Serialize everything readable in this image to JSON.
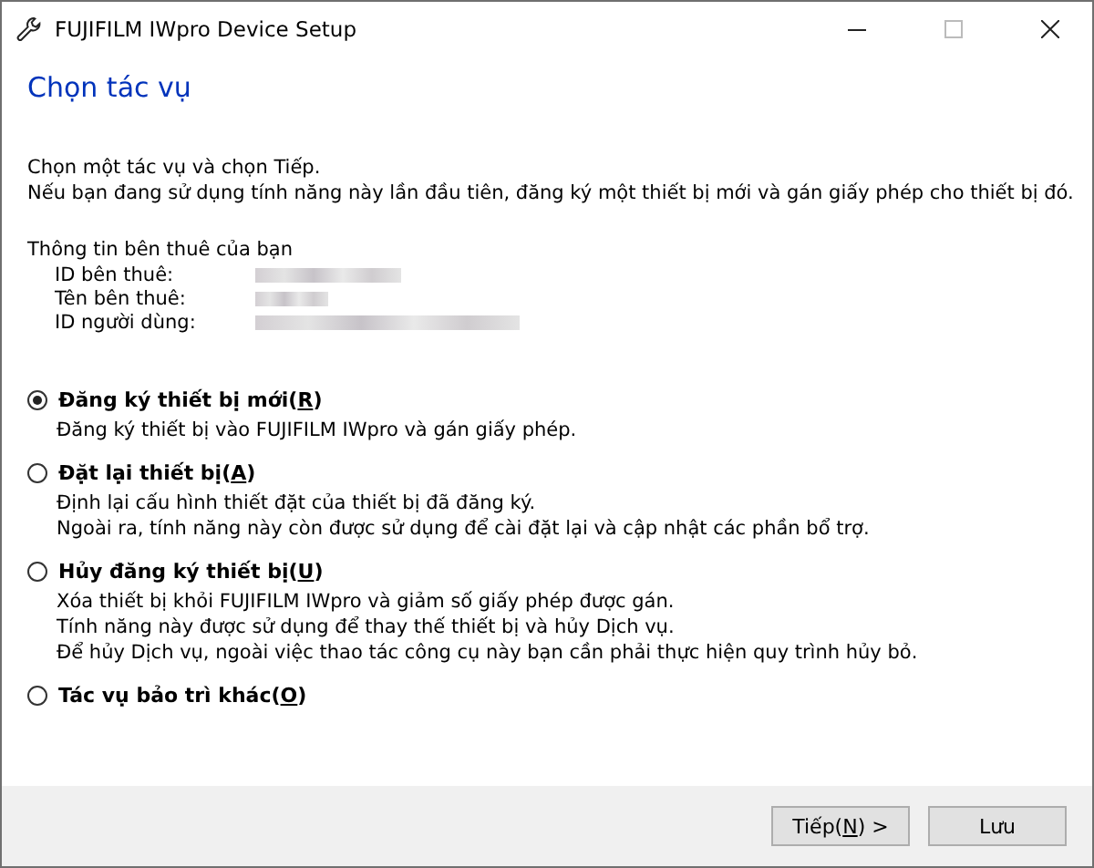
{
  "window": {
    "title": "FUJIFILM IWpro Device Setup"
  },
  "heading": "Chọn tác vụ",
  "intro": [
    "Chọn một tác vụ và chọn Tiếp.",
    "Nếu bạn đang sử dụng tính năng này lần đầu tiên, đăng ký một thiết bị mới và gán giấy phép cho thiết bị đó."
  ],
  "tenant": {
    "title": "Thông tin bên thuê của bạn",
    "rows": [
      {
        "label": "ID bên thuê:",
        "blurred": true
      },
      {
        "label": "Tên bên thuê:",
        "blurred": true
      },
      {
        "label": "ID người dùng:",
        "blurred": true
      }
    ]
  },
  "options": [
    {
      "label": "Đăng ký thiết bị mới(",
      "key": "R",
      "suffix": ")",
      "selected": true,
      "description": [
        "Đăng ký thiết bị vào FUJIFILM IWpro và gán giấy phép."
      ]
    },
    {
      "label": "Đặt lại thiết bị(",
      "key": "A",
      "suffix": ")",
      "selected": false,
      "description": [
        "Định lại cấu hình thiết đặt của thiết bị đã đăng ký.",
        "Ngoài ra, tính năng này còn được sử dụng để cài đặt lại và cập nhật các phần bổ trợ."
      ]
    },
    {
      "label": "Hủy đăng ký thiết bị(",
      "key": "U",
      "suffix": ")",
      "selected": false,
      "description": [
        "Xóa thiết bị khỏi FUJIFILM IWpro và giảm số giấy phép được gán.",
        "Tính năng này được sử dụng để thay thế thiết bị và hủy Dịch vụ.",
        "Để hủy Dịch vụ, ngoài việc thao tác công cụ này bạn cần phải thực hiện quy trình hủy bỏ."
      ]
    },
    {
      "label": "Tác vụ bảo trì khác(",
      "key": "O",
      "suffix": ")",
      "selected": false
    }
  ],
  "buttons": [
    {
      "label": "Tiếp(",
      "key": "N",
      "suffix": ") >"
    },
    {
      "label": "Lưu"
    }
  ]
}
